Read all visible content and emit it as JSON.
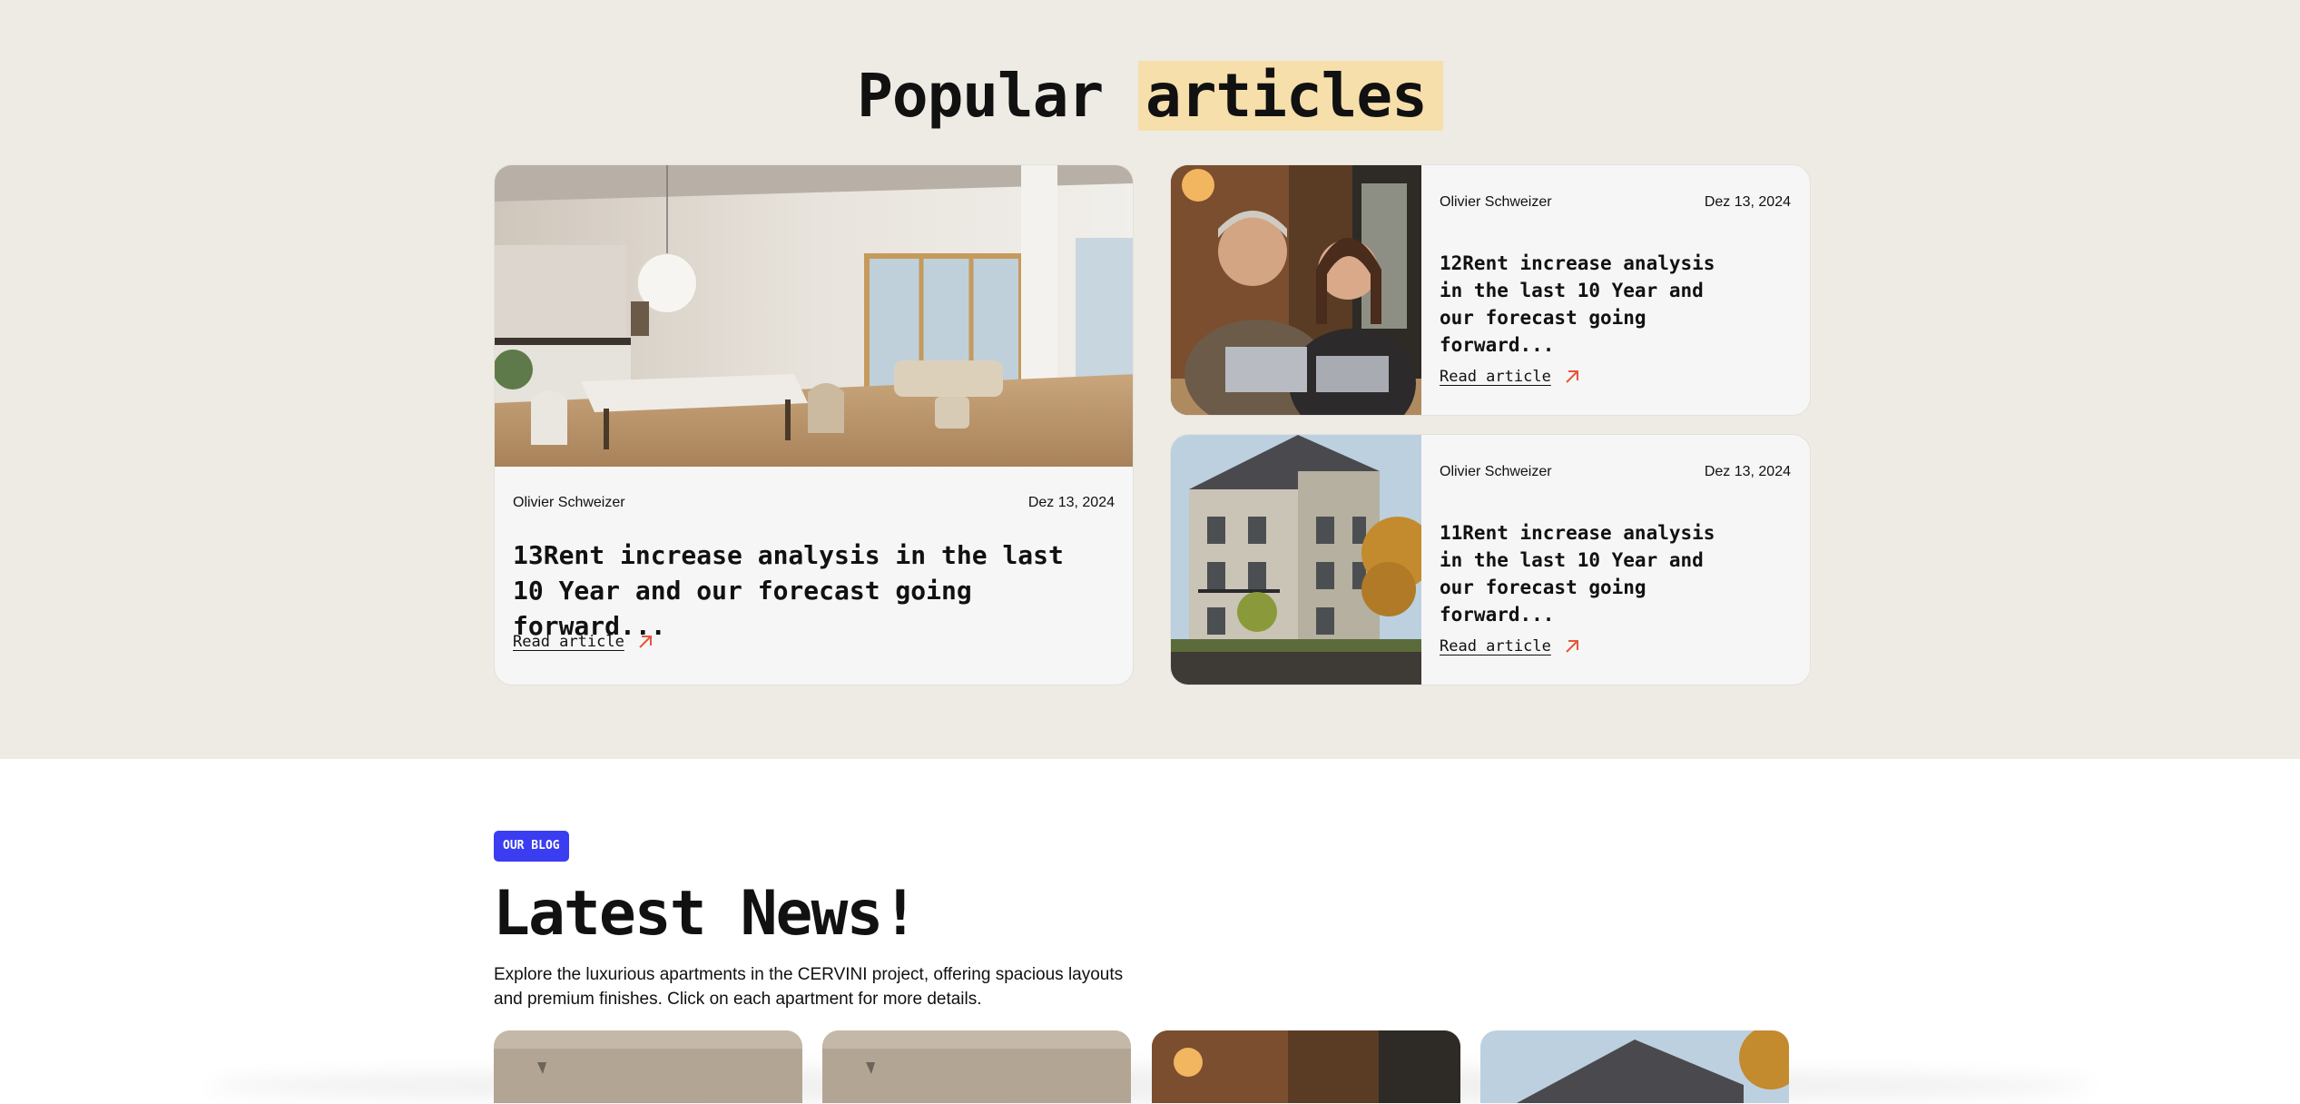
{
  "popular": {
    "title_part1": "Popular",
    "title_part2": "articles",
    "highlight_color": "#f6dfab",
    "background_color": "#eeebe4",
    "articles": [
      {
        "author": "Olivier Schweizer",
        "date": "Dez 13, 2024",
        "title": "13Rent increase analysis in the last 10 Year and our forecast going forward...",
        "link_label": "Read article",
        "image": "bright-apartment-interior-photo"
      },
      {
        "author": "Olivier Schweizer",
        "date": "Dez 13, 2024",
        "title": "12Rent increase analysis in the last 10 Year and our forecast going forward...",
        "link_label": "Read article",
        "image": "couple-with-laptops-photo"
      },
      {
        "author": "Olivier Schweizer",
        "date": "Dez 13, 2024",
        "title": "11Rent increase analysis in the last 10 Year and our forecast going forward...",
        "link_label": "Read article",
        "image": "apartment-building-exterior-photo"
      }
    ]
  },
  "blog": {
    "badge": "OUR BLOG",
    "badge_color": "#3b3df0",
    "title": "Latest News!",
    "description": "Explore the luxurious apartments in the CERVINI project, offering spacious layouts and premium finishes. Click on each apartment for more details.",
    "cards": [
      {
        "image": "interior-photo"
      },
      {
        "image": "interior-photo"
      },
      {
        "image": "couple-with-laptops-photo"
      },
      {
        "image": "apartment-building-exterior-photo"
      }
    ]
  },
  "colors": {
    "accent_arrow": "#e8553a",
    "card_background": "#f6f6f6"
  }
}
